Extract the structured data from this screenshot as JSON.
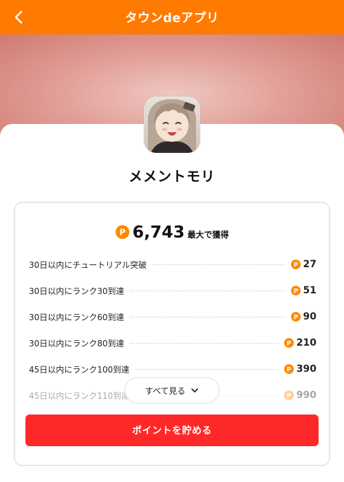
{
  "header": {
    "title": "タウンdeアプリ",
    "background": "#ff7a00"
  },
  "app": {
    "name": "メメントモリ"
  },
  "rewards": {
    "total_points": "6,743",
    "total_suffix": "最大で獲得",
    "coin_color": "#ff8a00",
    "items": [
      {
        "label": "30日以内にチュートリアル突破",
        "points": "27"
      },
      {
        "label": "30日以内にランク30到達",
        "points": "51"
      },
      {
        "label": "30日以内にランク60到達",
        "points": "90"
      },
      {
        "label": "30日以内にランク80到達",
        "points": "210"
      },
      {
        "label": "45日以内にランク100到達",
        "points": "390"
      },
      {
        "label": "45日以内にランク110到達",
        "points": "990"
      }
    ],
    "see_all_label": "すべて見る"
  },
  "cta": {
    "label": "ポイントを貯める",
    "color": "#ff2828"
  }
}
